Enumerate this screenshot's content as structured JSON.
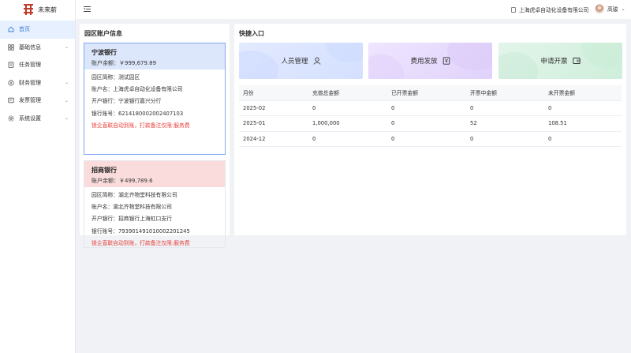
{
  "app": {
    "logo_text": "未来薪"
  },
  "sidebar": {
    "items": [
      {
        "label": "首页",
        "icon": "home-icon",
        "has_arrow": false
      },
      {
        "label": "基础信息",
        "icon": "grid-icon",
        "has_arrow": true
      },
      {
        "label": "任务管理",
        "icon": "task-icon",
        "has_arrow": false
      },
      {
        "label": "财务管理",
        "icon": "finance-icon",
        "has_arrow": true
      },
      {
        "label": "发票管理",
        "icon": "invoice-icon",
        "has_arrow": true
      },
      {
        "label": "系统设置",
        "icon": "gear-icon",
        "has_arrow": true
      }
    ]
  },
  "header": {
    "company": "上海虎卓自动化设备有限公司",
    "user": "高骏"
  },
  "left_panel": {
    "title": "园区账户信息",
    "cards": [
      {
        "bank": "宁波银行",
        "balance": "账户余额：￥999,679.89",
        "rows": [
          "园区简称：测试园区",
          "账户名：上海虎卓自动化设备有限公司",
          "开户银行：宁波银行嘉兴分行",
          "银行账号：621418000200240​7103"
        ],
        "notice": "锁企直联自动到账，打款备注仅限:服务费"
      },
      {
        "bank": "招商银行",
        "balance": "账户余额：￥499,789.6",
        "rows": [
          "园区简称：湖北齐物堂科技有限公司",
          "账户名：湖北齐物堂科技有限公司",
          "开户银行：招商银行上海虹口支行",
          "银行账号：793901491010002201245"
        ],
        "notice": "锁企直联自动到账，打款备注仅限:服务费"
      }
    ]
  },
  "right_panel": {
    "title": "快捷入口",
    "quick": [
      "人员管理",
      "费用发放",
      "申请开票"
    ],
    "table": {
      "headers": [
        "月份",
        "充值总金额",
        "已开票金额",
        "开票中金额",
        "未开票金额"
      ],
      "rows": [
        [
          "2025-02",
          "0",
          "0",
          "0",
          "0"
        ],
        [
          "2025-01",
          "1,000,000",
          "0",
          "52",
          "108.51"
        ],
        [
          "2024-12",
          "0",
          "0",
          "0",
          "0"
        ]
      ]
    }
  },
  "colors": {
    "accent": "#3a7bd5",
    "notice": "#e6423b"
  }
}
